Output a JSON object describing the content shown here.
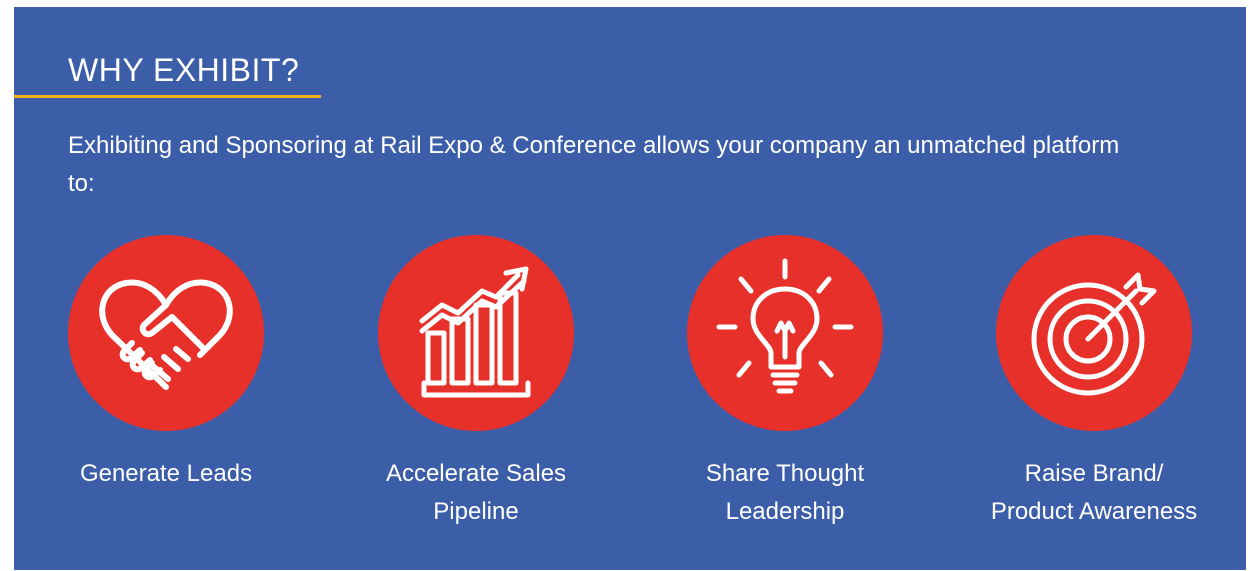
{
  "section": {
    "heading": "WHY EXHIBIT?",
    "intro": "Exhibiting and Sponsoring at Rail Expo & Conference allows your company an unmatched platform to:"
  },
  "benefits": [
    {
      "icon": "handshake-heart-icon",
      "line1": "Generate Leads",
      "line2": ""
    },
    {
      "icon": "growth-chart-icon",
      "line1": "Accelerate Sales",
      "line2": "Pipeline"
    },
    {
      "icon": "lightbulb-icon",
      "line1": "Share Thought",
      "line2": "Leadership"
    },
    {
      "icon": "target-arrow-icon",
      "line1": "Raise Brand/",
      "line2": "Product Awareness"
    }
  ],
  "colors": {
    "background": "#3c5ea8",
    "accent_underline": "#f2ad1a",
    "icon_circle": "#e8302a",
    "text": "#ffffff"
  }
}
